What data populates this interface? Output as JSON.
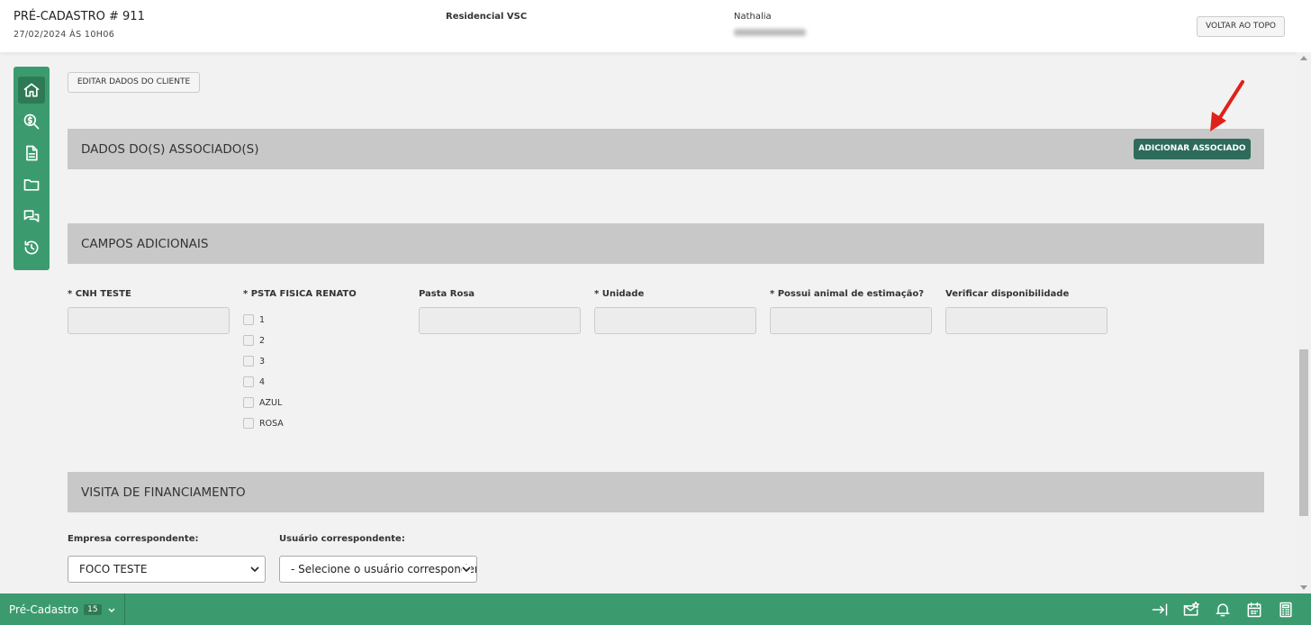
{
  "header": {
    "title": "PRÉ-CADASTRO # 911",
    "date": "27/02/2024 ÀS 10H06",
    "project": "Residencial VSC",
    "client_name": "Nathalia",
    "back_to_top": "VOLTAR AO TOPO"
  },
  "edit_client_label": "EDITAR DADOS DO CLIENTE",
  "sidebar": [
    "home-icon",
    "search-dollar-icon",
    "document-icon",
    "folder-icon",
    "chat-icon",
    "history-icon"
  ],
  "sections": {
    "associates": {
      "title": "DADOS DO(S) ASSOCIADO(S)",
      "add_label": "ADICIONAR ASSOCIADO"
    },
    "additional": {
      "title": "CAMPOS ADICIONAIS"
    },
    "financing": {
      "title": "VISITA DE FINANCIAMENTO"
    }
  },
  "fields": {
    "cnh": "* CNH TESTE",
    "psta": "* PSTA FISICA RENATO",
    "pasta_rosa": "Pasta Rosa",
    "unidade": "* Unidade",
    "animal": "* Possui animal de estimação?",
    "disponibilidade": "Verificar disponibilidade"
  },
  "checkboxes": [
    "1",
    "2",
    "3",
    "4",
    "AZUL",
    "ROSA"
  ],
  "financing": {
    "company_label": "Empresa correspondente:",
    "company_value": "FOCO TESTE",
    "user_label": "Usuário correspondente:",
    "user_value": "- Selecione o usuário correspondente -"
  },
  "bottombar": {
    "tab_label": "Pré-Cadastro",
    "tab_count": "15",
    "icons": [
      "exit-icon",
      "mail-star-icon",
      "bell-icon",
      "calendar-icon",
      "calculator-icon"
    ]
  },
  "colors": {
    "brand_green": "#3c9b6e",
    "dark_button": "#2e6b5a",
    "section_gray": "#c8c8c8"
  }
}
